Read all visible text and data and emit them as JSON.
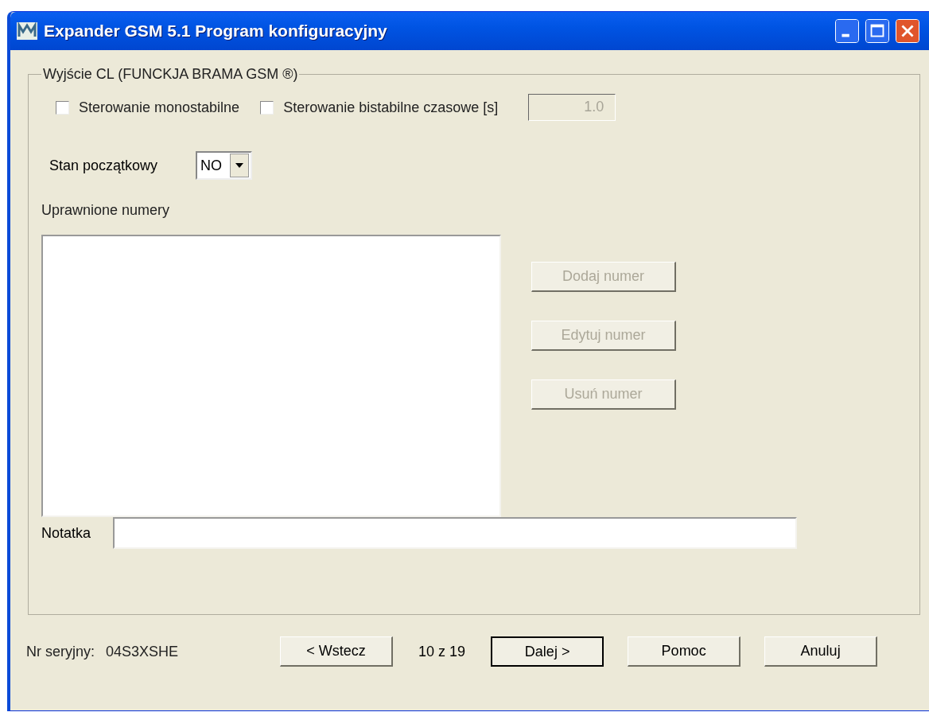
{
  "window": {
    "title": "Expander GSM 5.1 Program konfiguracyjny"
  },
  "group": {
    "title": "Wyjście CL  (FUNCKJA BRAMA GSM ®)",
    "checkboxes": [
      {
        "label": "Sterowanie monostabilne",
        "checked": false
      },
      {
        "label": "Sterowanie bistabilne czasowe [s]",
        "checked": false
      }
    ],
    "time_field": {
      "value": "1.0",
      "disabled": true
    },
    "initial_state": {
      "label": "Stan początkowy",
      "value": "NO"
    },
    "numbers": {
      "label": "Uprawnione numery"
    },
    "number_buttons": [
      {
        "label": "Dodaj numer",
        "disabled": true
      },
      {
        "label": "Edytuj numer",
        "disabled": true
      },
      {
        "label": "Usuń numer",
        "disabled": true
      }
    ],
    "note": {
      "label": "Notatka"
    }
  },
  "footer": {
    "serial_label": "Nr seryjny:",
    "serial": "04S3XSHE",
    "page": "10 z 19",
    "buttons": [
      {
        "label": "< Wstecz",
        "default": false
      },
      {
        "label": "Dalej >",
        "default": true
      },
      {
        "label": "Pomoc",
        "default": false
      },
      {
        "label": "Anuluj",
        "default": false
      }
    ]
  }
}
